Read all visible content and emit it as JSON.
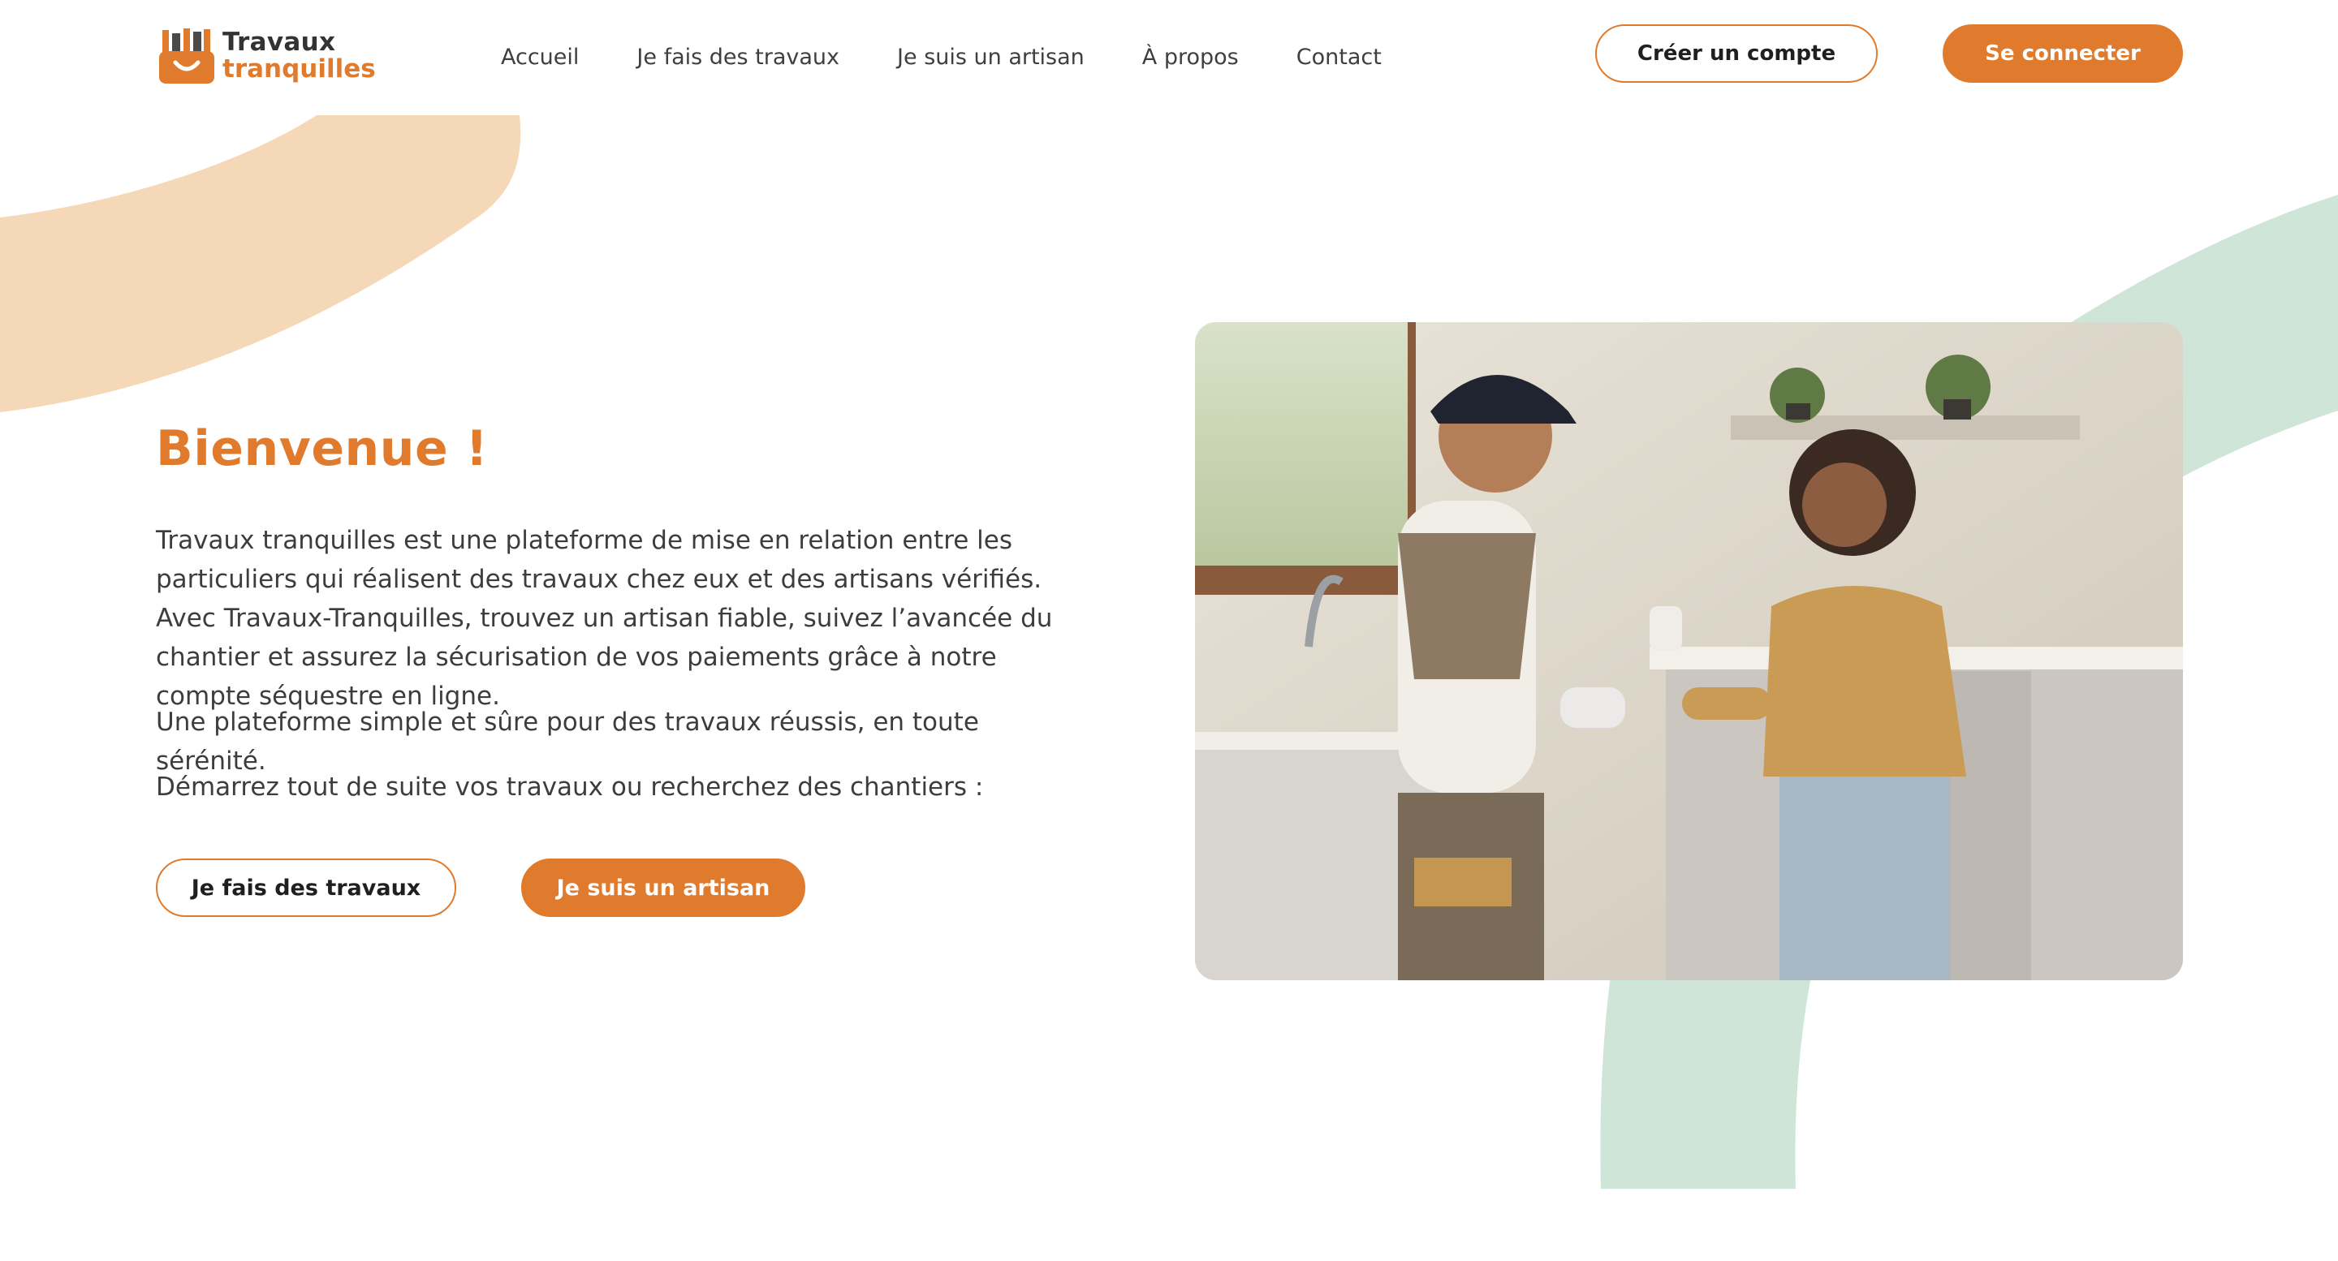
{
  "brand": {
    "line1": "Travaux",
    "line2": "tranquilles",
    "primary_color": "#e07b2e",
    "peach_color": "#f5d8b8",
    "green_color": "#cfe5d8",
    "logo_icon": "toolbox-smile-icon"
  },
  "nav": {
    "items": [
      {
        "label": "Accueil"
      },
      {
        "label": "Je fais des travaux"
      },
      {
        "label": "Je suis un artisan"
      },
      {
        "label": "À propos"
      },
      {
        "label": "Contact"
      }
    ]
  },
  "header_actions": {
    "create_account": "Créer un compte",
    "login": "Se connecter"
  },
  "hero": {
    "title": "Bienvenue !",
    "paragraph1": "Travaux tranquilles est une plateforme de mise en relation entre les particuliers qui réalisent des travaux chez eux et des artisans vérifiés. Avec Travaux-Tranquilles, trouvez un artisan fiable, suivez l’avancée du chantier et assurez la sécurisation de vos paiements grâce à notre compte séquestre en ligne.",
    "paragraph2": "Une plateforme simple et sûre pour des travaux réussis, en toute sérénité.",
    "paragraph3": "Démarrez tout de suite vos travaux ou recherchez des chantiers :",
    "cta_homeowner": "Je fais des travaux",
    "cta_artisan": "Je suis un artisan"
  },
  "image": {
    "subject": "hero-photo-artisan-and-client-in-kitchen"
  }
}
